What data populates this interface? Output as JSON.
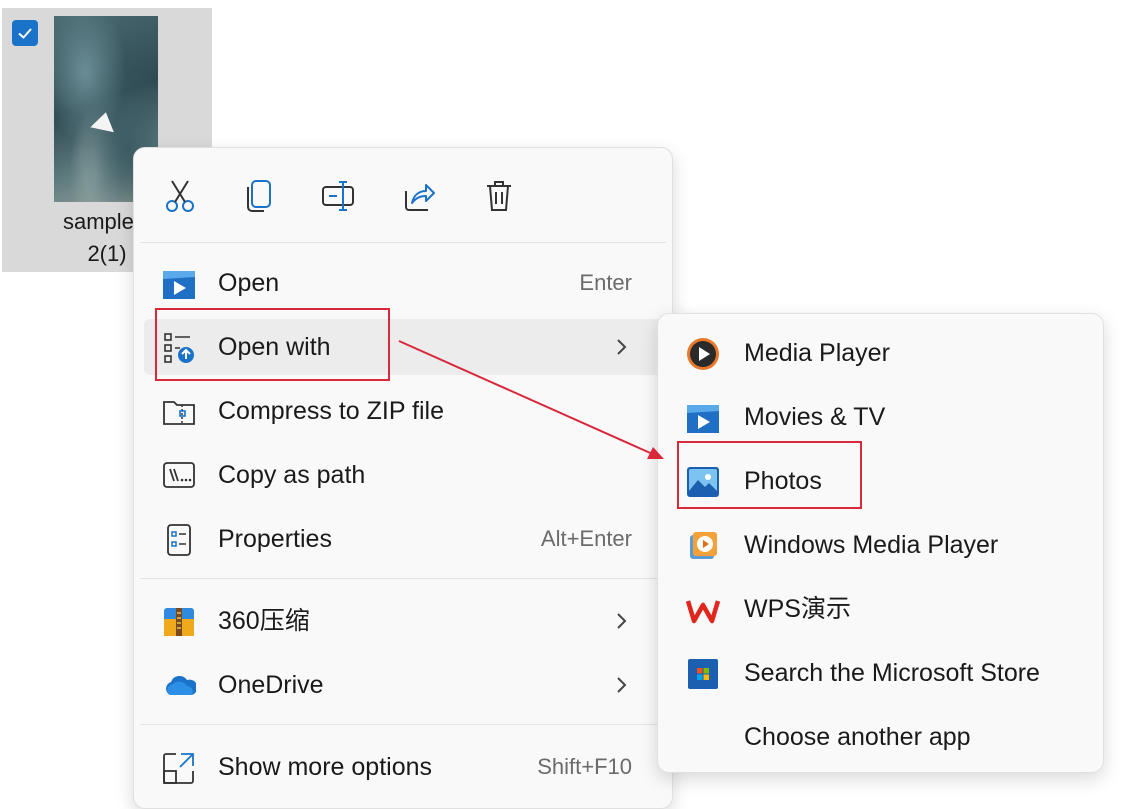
{
  "file": {
    "name_line1": "sample v",
    "name_line2": "2(1)",
    "selected": true
  },
  "toolbar": {
    "buttons": [
      {
        "name": "cut",
        "icon": "scissors-icon"
      },
      {
        "name": "copy",
        "icon": "copy-icon"
      },
      {
        "name": "rename",
        "icon": "rename-icon"
      },
      {
        "name": "share",
        "icon": "share-icon"
      },
      {
        "name": "delete",
        "icon": "trash-icon"
      }
    ]
  },
  "menu": {
    "items": [
      {
        "label": "Open",
        "shortcut": "Enter",
        "icon": "movies-tv-app-icon"
      },
      {
        "label": "Open with",
        "shortcut": "",
        "icon": "open-with-icon",
        "submenu": true
      },
      {
        "label": "Compress to ZIP file",
        "shortcut": "",
        "icon": "zip-folder-icon"
      },
      {
        "label": "Copy as path",
        "shortcut": "",
        "icon": "copy-path-icon"
      },
      {
        "label": "Properties",
        "shortcut": "Alt+Enter",
        "icon": "properties-icon"
      },
      {
        "label": "360压缩",
        "shortcut": "",
        "icon": "360-zip-icon",
        "submenu": true
      },
      {
        "label": "OneDrive",
        "shortcut": "",
        "icon": "onedrive-cloud-icon",
        "submenu": true
      },
      {
        "label": "Show more options",
        "shortcut": "Shift+F10",
        "icon": "show-more-options-icon"
      }
    ]
  },
  "submenu": {
    "items": [
      {
        "label": "Media Player",
        "icon": "media-player-icon"
      },
      {
        "label": "Movies & TV",
        "icon": "movies-tv-icon"
      },
      {
        "label": "Photos",
        "icon": "photos-icon"
      },
      {
        "label": "Windows Media Player",
        "icon": "windows-media-player-icon"
      },
      {
        "label": "WPS演示",
        "icon": "wps-icon"
      },
      {
        "label": "Search the Microsoft Store",
        "icon": "microsoft-store-icon"
      },
      {
        "label": "Choose another app",
        "icon": ""
      }
    ]
  },
  "colors": {
    "accent": "#1a73c9",
    "highlight": "#d8283a",
    "menu_bg": "#f9f9f9"
  }
}
